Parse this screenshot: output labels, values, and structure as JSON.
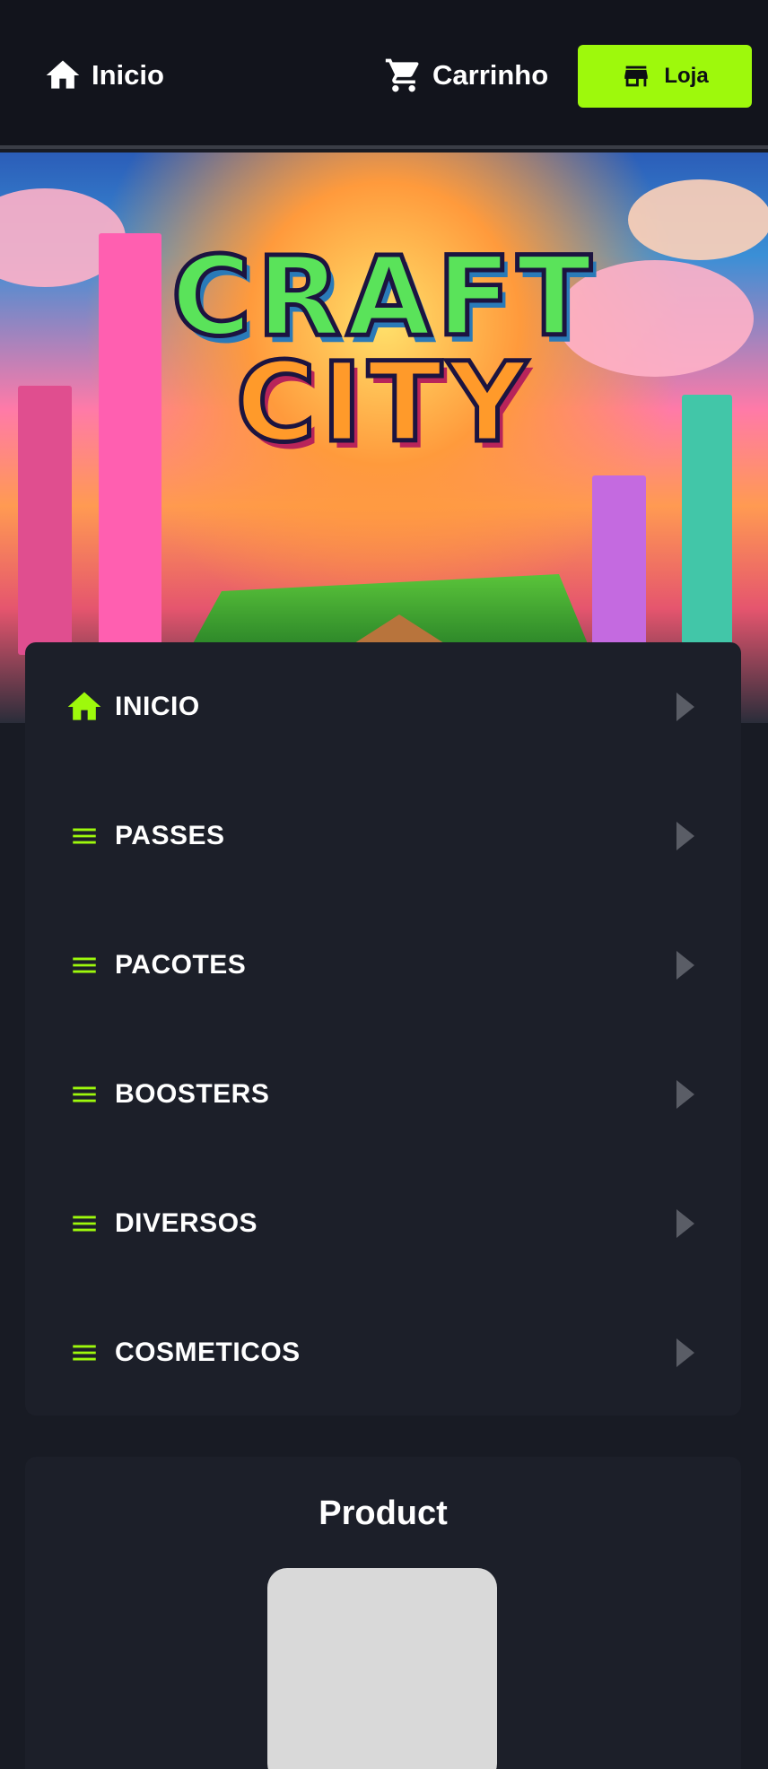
{
  "nav": {
    "home_label": "Inicio",
    "cart_label": "Carrinho",
    "store_label": "Loja"
  },
  "banner": {
    "logo_line1": "CRAFT",
    "logo_line2": "CITY"
  },
  "categories": [
    {
      "label": "INICIO",
      "icon": "home-icon"
    },
    {
      "label": "PASSES",
      "icon": "menu-lines-icon"
    },
    {
      "label": "PACOTES",
      "icon": "menu-lines-icon"
    },
    {
      "label": "BOOSTERS",
      "icon": "menu-lines-icon"
    },
    {
      "label": "DIVERSOS",
      "icon": "menu-lines-icon"
    },
    {
      "label": "COSMETICOS",
      "icon": "menu-lines-icon"
    }
  ],
  "product": {
    "title": "Product"
  },
  "colors": {
    "accent": "#9ef90c",
    "background": "#181b24",
    "panel": "#1c1f29",
    "topbar": "#12141c"
  }
}
